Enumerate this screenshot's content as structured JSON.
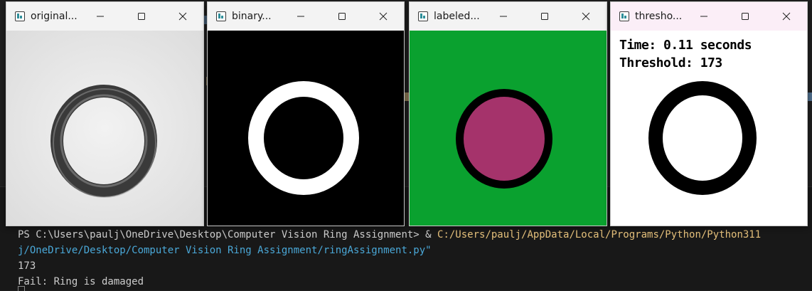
{
  "windows": [
    {
      "title": "original...",
      "kind": "grayscale"
    },
    {
      "title": "binary...",
      "kind": "binary"
    },
    {
      "title": "labeled...",
      "kind": "labeled"
    },
    {
      "title": "thresho...",
      "kind": "threshold"
    }
  ],
  "threshold_window": {
    "time_text": "Time: 0.11 seconds",
    "threshold_text": "Threshold: 173"
  },
  "terminal": {
    "prompt_prefix": "PS C:\\Users\\paulj\\OneDrive\\Desktop\\Computer Vision Ring Assignment> & ",
    "command_path": "C:/Users/paulj/AppData/Local/Programs/Python/Python311",
    "command_continuation": "j/OneDrive/Desktop/Computer Vision Ring Assignment/ringAssignment.py\"",
    "output_threshold": "173",
    "output_result": "Fail: Ring is damaged"
  },
  "colors": {
    "labeled_background": "#0aa12f",
    "labeled_fill": "#a5336b",
    "terminal_path": "#e5c07b"
  },
  "icons": [
    "app-icon",
    "minimize-icon",
    "maximize-icon",
    "close-icon"
  ]
}
